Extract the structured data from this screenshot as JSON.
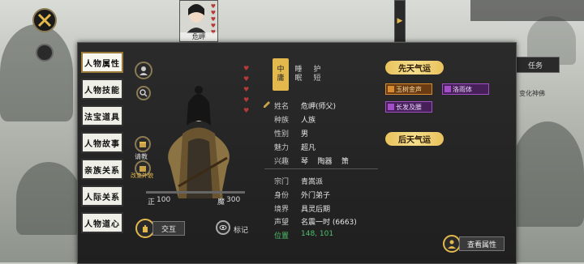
{
  "top_avatar": {
    "name": "危岬",
    "hearts": 5
  },
  "left_tabs": [
    {
      "label": "人物属性",
      "active": true
    },
    {
      "label": "人物技能",
      "active": false
    },
    {
      "label": "法宝道具",
      "active": false
    },
    {
      "label": "人物故事",
      "active": false
    },
    {
      "label": "亲族关系",
      "active": false
    },
    {
      "label": "人际关系",
      "active": false
    },
    {
      "label": "人物道心",
      "active": false
    }
  ],
  "portrait_actions": {
    "gift": "请教",
    "appearance": "改变外貌"
  },
  "stats": {
    "zheng_label": "正",
    "zheng_value": "100",
    "mo_label": "魔",
    "mo_value": "300"
  },
  "interact_label": "交互",
  "mark_label": "标记",
  "view_tabs": [
    {
      "label": "中\n庸",
      "active": true
    },
    {
      "label": "睡\n眠",
      "active": false
    },
    {
      "label": "护\n短",
      "active": false
    }
  ],
  "info_rows": [
    {
      "key": "姓名",
      "value": "危岬(师父)"
    },
    {
      "key": "种族",
      "value": "人族"
    },
    {
      "key": "性别",
      "value": "男"
    },
    {
      "key": "魅力",
      "value": "超凡"
    },
    {
      "key": "兴趣",
      "value": "琴    陶器    箫"
    }
  ],
  "sect_rows": [
    {
      "key": "宗门",
      "value": "青嵩派"
    },
    {
      "key": "身份",
      "value": "外门弟子"
    },
    {
      "key": "境界",
      "value": "具灵后期"
    },
    {
      "key": "声望",
      "value": "名震一时 (6663)"
    },
    {
      "key": "位置",
      "value": "148, 101"
    }
  ],
  "innate_title": "先天气运",
  "innate_traits": [
    {
      "label": "玉树金声",
      "color": "#d88a2e"
    },
    {
      "label": "洛雨体",
      "color": "#a24fc7"
    },
    {
      "label": "长发及腰",
      "color": "#a24fc7"
    }
  ],
  "acquired_title": "后天气运",
  "view_attr_label": "查看属性",
  "right_side": {
    "task": "任务",
    "mini": "变化神佛"
  },
  "colors": {
    "accent_gold": "#e9c25b",
    "position_green": "#4fc06a",
    "heart_red": "#b53a3a"
  }
}
